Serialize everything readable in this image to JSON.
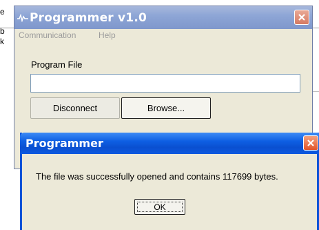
{
  "background": {
    "fragments": [
      "e",
      "b",
      "k"
    ]
  },
  "main_window": {
    "title": "Programmer v1.0",
    "title_icon": "waveform-icon",
    "close_icon": "close-icon",
    "menu": [
      "Communication",
      "Help"
    ],
    "program_file_label": "Program File",
    "program_file_value": "",
    "disconnect_label": "Disconnect",
    "browse_label": "Browse..."
  },
  "dialog": {
    "title": "Programmer",
    "close_icon": "close-icon",
    "message": "The file was successfully opened and contains 117699 bytes.",
    "ok_label": "OK"
  },
  "colors": {
    "main_titlebar": "#8ea6d6",
    "dialog_titlebar": "#0e5fe3",
    "window_face": "#ece9d8",
    "close_red": "#e2542a"
  }
}
